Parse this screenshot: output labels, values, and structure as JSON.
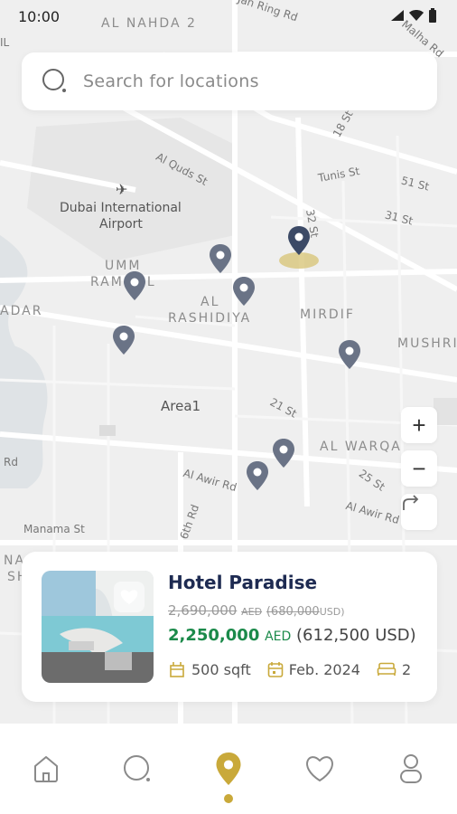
{
  "status_bar": {
    "time": "10:00"
  },
  "search": {
    "placeholder": "Search for locations"
  },
  "map": {
    "airport_line1": "Dubai International",
    "airport_line2": "Airport",
    "areas": {
      "al_nahda": "AL NAHDA 2",
      "umm_ramool_1": "UMM",
      "umm_ramool_2": "RAMOOL",
      "al_rashidiya_1": "AL",
      "al_rashidiya_2": "RASHIDIYA",
      "mirdif": "MIRDIF",
      "mushrif": "MUSHRI",
      "al_warqa": "AL WARQA",
      "adar": "ADAR",
      "area1": "Area1",
      "rd": "Rd",
      "nash_1": "NA",
      "nash_2": "SH"
    },
    "roads": {
      "ring_rd": "Jah Ring Rd",
      "malha": "Malha Rd",
      "al_quds": "Al Quds St",
      "tunis": "Tunis St",
      "st_51": "51 St",
      "st_31": "31 St",
      "st_18": "18 St",
      "st_32": "32 St",
      "st_21": "21 St",
      "st_25": "25 St",
      "al_awir_1": "Al Awir Rd",
      "al_awir_2": "Al Awir Rd",
      "rd_6th": "6th Rd",
      "manama": "Manama St",
      "il": "IL"
    }
  },
  "zoom": {
    "in": "+",
    "out": "−"
  },
  "listing": {
    "title": "Hotel Paradise",
    "old_price": "2,690,000",
    "old_currency": "AED",
    "old_usd": "(680,000",
    "old_usd_cur": "USD)",
    "price": "2,250,000",
    "currency": "AED",
    "price_usd": "(612,500 USD)",
    "area": "500 sqft",
    "date": "Feb. 2024",
    "beds": "2"
  },
  "colors": {
    "gold": "#c9a93a",
    "pin": "#6a7386",
    "pin_active": "#3c4a66",
    "green": "#1b8a4a",
    "navy": "#1e2b52"
  },
  "icons": [
    "search-icon",
    "map-pin-icon",
    "airport-icon",
    "heart-icon",
    "area-icon",
    "calendar-icon",
    "bed-icon",
    "home-icon",
    "user-icon",
    "route-icon"
  ]
}
